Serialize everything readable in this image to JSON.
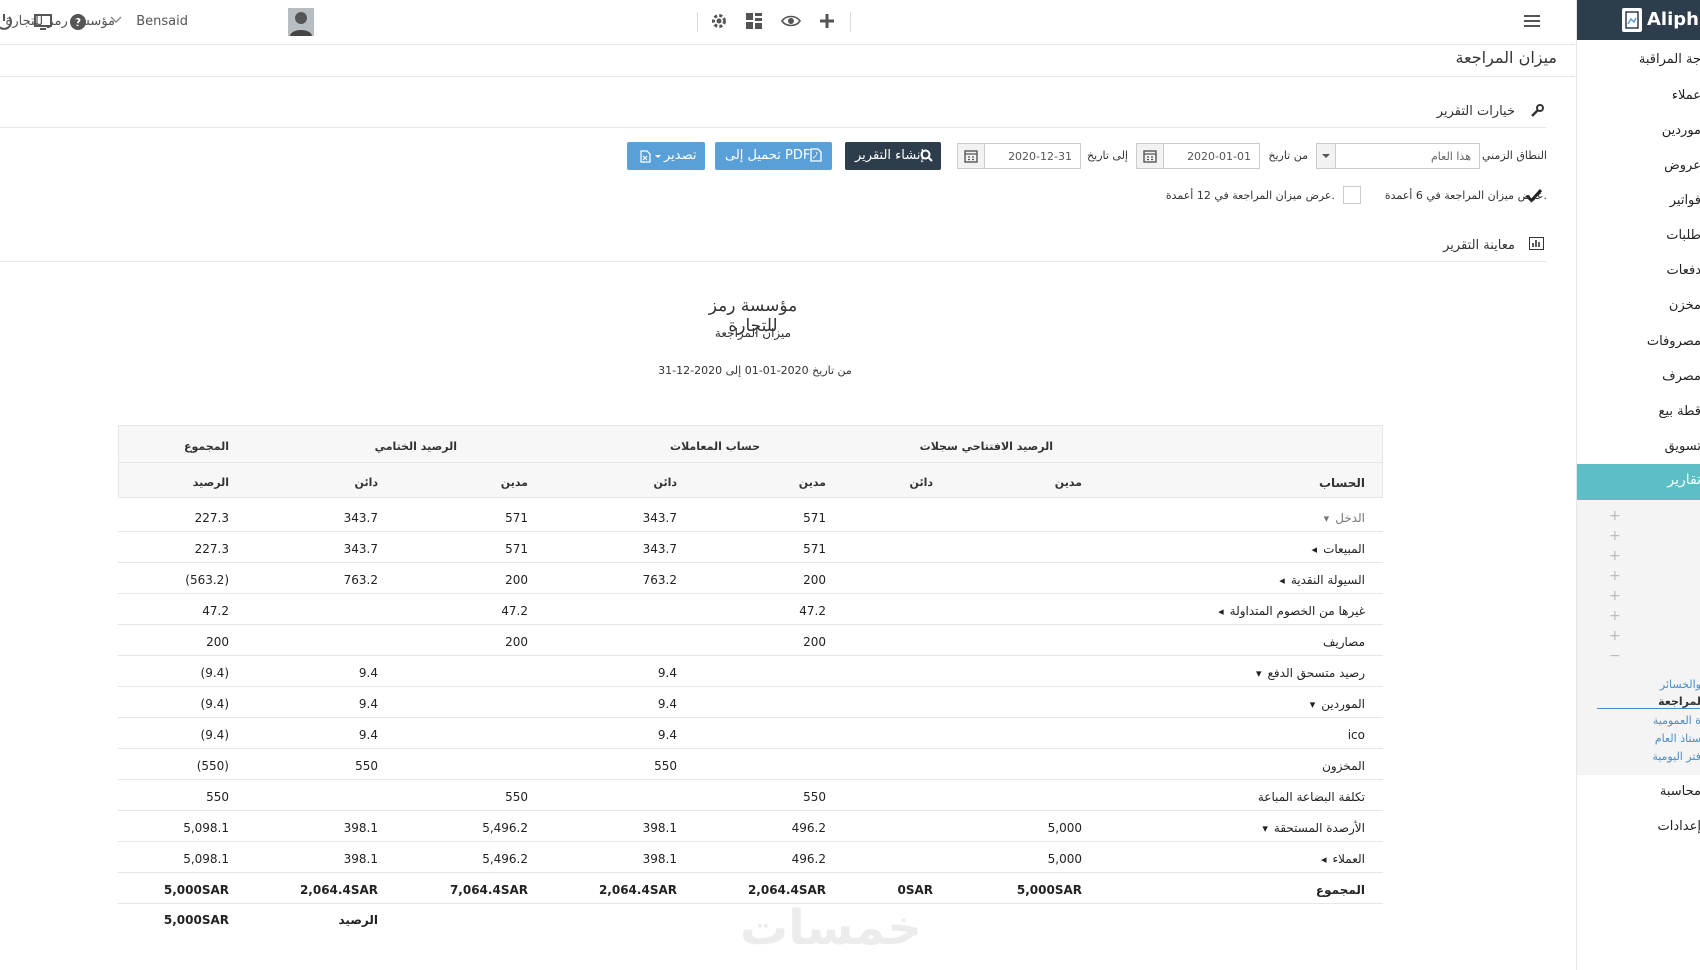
{
  "topbar": {
    "company": "مؤسسة رمز للتجارة",
    "user": "Bensaid"
  },
  "page": {
    "title": "ميزان المراجعة"
  },
  "sidebar": {
    "brand": "Aliphia",
    "items": [
      "جة المراقبة",
      "عملاء",
      "موردين",
      "عروض",
      "فواتير",
      "طلبات",
      "دفعات",
      "مخزن",
      "مصروفات",
      "مصرف",
      "قطة بيع",
      "تسويق"
    ],
    "active": "تقارير",
    "sublinks": [
      "والخسائر",
      "لمراجعة",
      "ة العمومية",
      "ستاذ العام",
      "فتر اليومية"
    ],
    "bottom": [
      "محاسبة",
      "إعدادات"
    ]
  },
  "options": {
    "section_title": "خيارات التقرير",
    "range_label": "النطاق الزمني",
    "range_value": "هذا العام",
    "from_label": "من تاريخ",
    "from_value": "2020-01-01",
    "to_label": "إلى تاريخ",
    "to_value": "2020-12-31",
    "create_btn": "إنشاء التقرير",
    "pdf_btn": "تحميل إلى PDF",
    "export_btn": "تصدير",
    "check6": "عرض ميزان المراجعة في 6 أعمدة.",
    "check12": "عرض ميزان المراجعة في 12 أعمدة.",
    "check6_checked": true,
    "check12_checked": false
  },
  "preview": {
    "title": "معاينة التقرير"
  },
  "report": {
    "company": "مؤسسة رمز للتجارة",
    "title": "ميزان المراجعة",
    "range": "من تاريخ 2020-01-01 إلى 2020-12-31",
    "group_headers": {
      "opening": "الرصيد الافتتاحي سجلات",
      "transactions": "حساب المعاملات",
      "closing": "الرصيد الختامي",
      "total": "المجموع"
    },
    "col_headers": {
      "account": "الحساب",
      "op_debit": "مدين",
      "op_credit": "دائن",
      "tr_debit": "مدين",
      "tr_credit": "دائن",
      "cl_debit": "مدين",
      "cl_credit": "دائن",
      "balance": "الرصيد"
    },
    "rows": [
      {
        "account": "الدخل",
        "caret": "▾",
        "muted": true,
        "op_d": "",
        "op_c": "",
        "tr_d": "571",
        "tr_c": "343.7",
        "cl_d": "571",
        "cl_c": "343.7",
        "bal": "227.3"
      },
      {
        "account": "المبيعات",
        "caret": "◂",
        "op_d": "",
        "op_c": "",
        "tr_d": "571",
        "tr_c": "343.7",
        "cl_d": "571",
        "cl_c": "343.7",
        "bal": "227.3"
      },
      {
        "account": "السيولة النقدية",
        "caret": "◂",
        "op_d": "",
        "op_c": "",
        "tr_d": "200",
        "tr_c": "763.2",
        "cl_d": "200",
        "cl_c": "763.2",
        "bal": "(563.2)"
      },
      {
        "account": "غيرها من الخصوم المتداولة",
        "caret": "◂",
        "op_d": "",
        "op_c": "",
        "tr_d": "47.2",
        "tr_c": "",
        "cl_d": "47.2",
        "cl_c": "",
        "bal": "47.2"
      },
      {
        "account": "مصاريف",
        "caret": "",
        "op_d": "",
        "op_c": "",
        "tr_d": "200",
        "tr_c": "",
        "cl_d": "200",
        "cl_c": "",
        "bal": "200"
      },
      {
        "account": "رصيد متسحق الدفع",
        "caret": "▾",
        "op_d": "",
        "op_c": "",
        "tr_d": "",
        "tr_c": "9.4",
        "cl_d": "",
        "cl_c": "9.4",
        "bal": "(9.4)"
      },
      {
        "account": "الموردين",
        "caret": "▾",
        "op_d": "",
        "op_c": "",
        "tr_d": "",
        "tr_c": "9.4",
        "cl_d": "",
        "cl_c": "9.4",
        "bal": "(9.4)"
      },
      {
        "account": "ico",
        "caret": "",
        "op_d": "",
        "op_c": "",
        "tr_d": "",
        "tr_c": "9.4",
        "cl_d": "",
        "cl_c": "9.4",
        "bal": "(9.4)"
      },
      {
        "account": "المخزون",
        "caret": "",
        "op_d": "",
        "op_c": "",
        "tr_d": "",
        "tr_c": "550",
        "cl_d": "",
        "cl_c": "550",
        "bal": "(550)"
      },
      {
        "account": "تكلفة البضاعة المباعة",
        "caret": "",
        "op_d": "",
        "op_c": "",
        "tr_d": "550",
        "tr_c": "",
        "cl_d": "550",
        "cl_c": "",
        "bal": "550"
      },
      {
        "account": "الأرصدة المستحقة",
        "caret": "▾",
        "op_d": "5,000",
        "op_c": "",
        "tr_d": "496.2",
        "tr_c": "398.1",
        "cl_d": "5,496.2",
        "cl_c": "398.1",
        "bal": "5,098.1"
      },
      {
        "account": "العملاء",
        "caret": "◂",
        "op_d": "5,000",
        "op_c": "",
        "tr_d": "496.2",
        "tr_c": "398.1",
        "cl_d": "5,496.2",
        "cl_c": "398.1",
        "bal": "5,098.1"
      }
    ],
    "total_row": {
      "account": "المجموع",
      "op_d": "5,000SAR",
      "op_c": "0SAR",
      "tr_d": "2,064.4SAR",
      "tr_c": "2,064.4SAR",
      "cl_d": "7,064.4SAR",
      "cl_c": "2,064.4SAR",
      "bal": "5,000SAR"
    },
    "balance_row": {
      "label": "الرصيد",
      "value": "5,000SAR"
    }
  },
  "watermark": "خمسات",
  "colors": {
    "primary_btn": "#2e3d4c",
    "secondary_btn": "#5aa0d8",
    "sidebar_active": "#5bbfc5",
    "brand_bg": "#2e3d4c"
  }
}
